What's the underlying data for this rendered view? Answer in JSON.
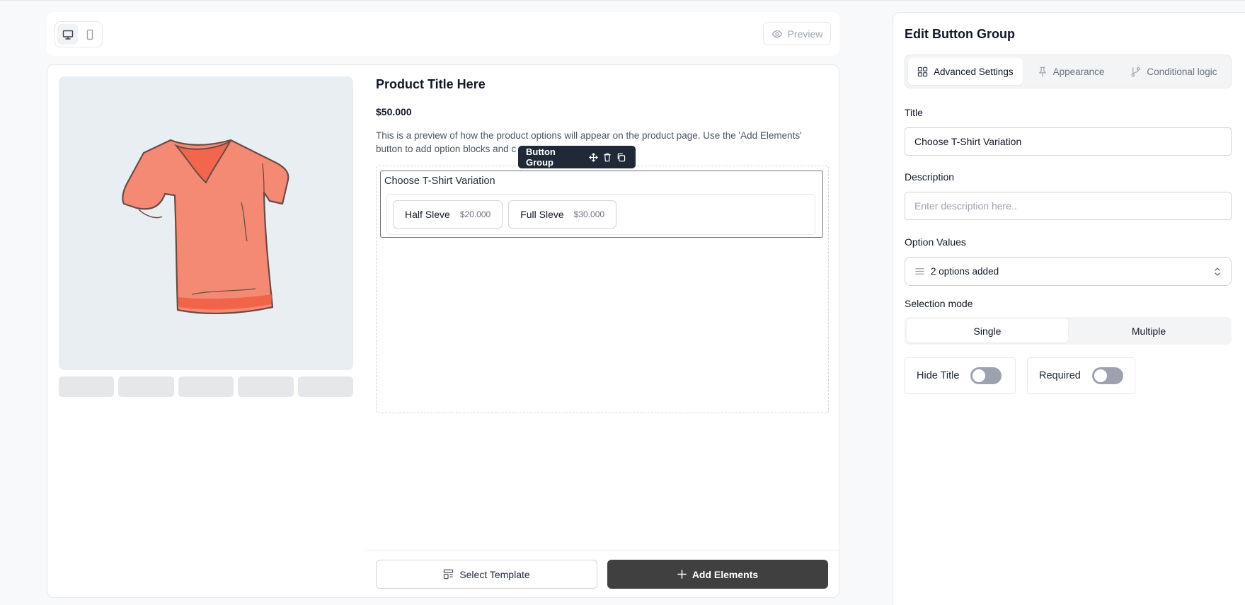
{
  "toolbar": {
    "preview_label": "Preview",
    "device_options": [
      "desktop",
      "mobile"
    ],
    "active_device": "desktop"
  },
  "product": {
    "title": "Product Title Here",
    "price": "$50.000",
    "description": "This is a preview of how the product options will appear on the product page. Use the 'Add Elements' button to add option blocks and c"
  },
  "block_toolbar": {
    "label": "Button Group"
  },
  "button_group": {
    "title": "Choose T-Shirt Variation",
    "options": [
      {
        "label": "Half Sleve",
        "price": "$20.000"
      },
      {
        "label": "Full Sleve",
        "price": "$30.000"
      }
    ]
  },
  "footer": {
    "select_template_label": "Select Template",
    "add_elements_label": "Add Elements"
  },
  "panel": {
    "title": "Edit Button Group",
    "tabs": [
      {
        "label": "Advanced Settings",
        "active": true
      },
      {
        "label": "Appearance",
        "active": false
      },
      {
        "label": "Conditional logic",
        "active": false
      }
    ],
    "title_field": {
      "label": "Title",
      "value": "Choose T-Shirt Variation"
    },
    "description_field": {
      "label": "Description",
      "placeholder": "Enter description here.."
    },
    "option_values": {
      "label": "Option Values",
      "value": "2 options added"
    },
    "selection_mode": {
      "label": "Selection mode",
      "options": [
        "Single",
        "Multiple"
      ],
      "selected": "Single"
    },
    "hide_title": {
      "label": "Hide Title",
      "on": false
    },
    "required": {
      "label": "Required",
      "on": false
    }
  },
  "colors": {
    "primary_button": "#404040",
    "block_toolbar": "#1f2937",
    "shirt": "#f58a74",
    "switch_off": "#9ca3af"
  }
}
